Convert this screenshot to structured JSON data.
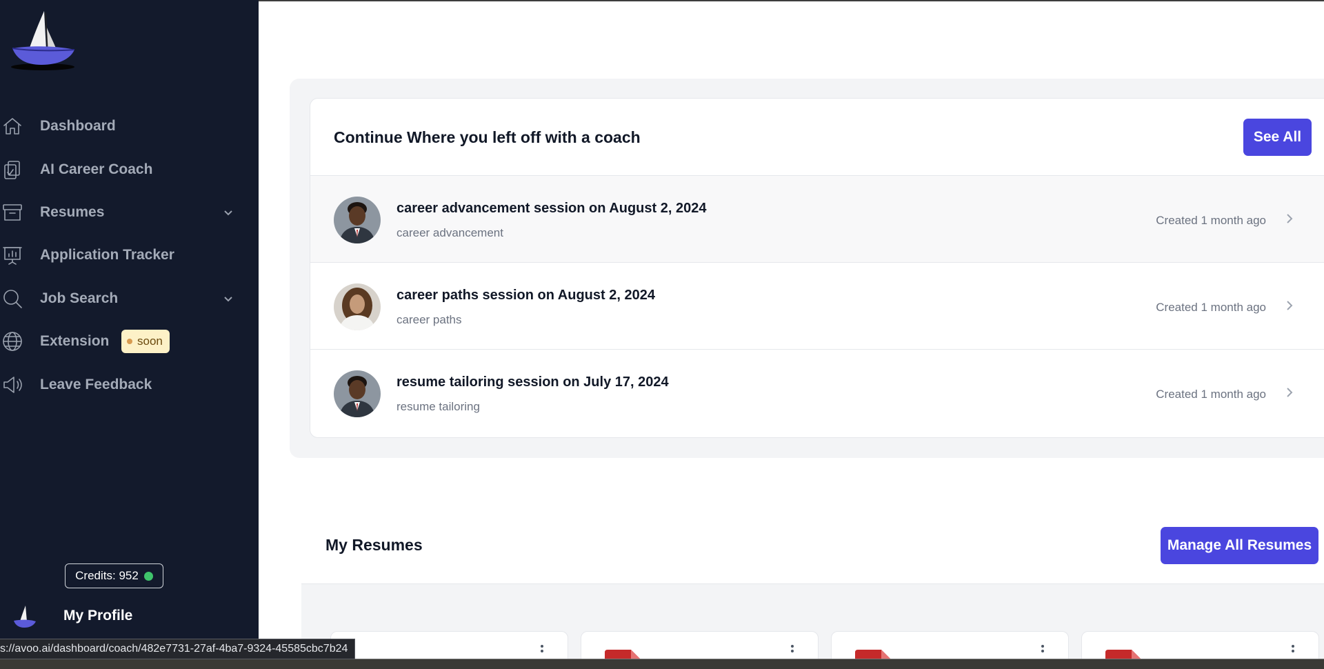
{
  "sidebar": {
    "items": [
      {
        "label": "Dashboard",
        "icon": "home-icon"
      },
      {
        "label": "AI Career Coach",
        "icon": "clipboard-check-icon"
      },
      {
        "label": "Resumes",
        "icon": "archive-icon"
      },
      {
        "label": "Application Tracker",
        "icon": "presentation-chart-icon"
      },
      {
        "label": "Job Search",
        "icon": "search-icon"
      },
      {
        "label": "Extension",
        "icon": "globe-icon"
      },
      {
        "label": "Leave Feedback",
        "icon": "megaphone-icon"
      }
    ],
    "soon_badge": "soon",
    "credits_label": "Credits: 952",
    "profile_label": "My Profile"
  },
  "status_url": "s://avoo.ai/dashboard/coach/482e7731-27af-4ba7-9324-45585cbc7b24",
  "coach": {
    "title": "Continue Where you left off with a coach",
    "see_all_label": "See All",
    "sessions": [
      {
        "title": "career advancement session on August 2, 2024",
        "subtitle": "career advancement",
        "created": "Created 1 month ago"
      },
      {
        "title": "career paths session on August 2, 2024",
        "subtitle": "career paths",
        "created": "Created 1 month ago"
      },
      {
        "title": "resume tailoring session on July 17, 2024",
        "subtitle": "resume tailoring",
        "created": "Created 1 month ago"
      }
    ]
  },
  "resumes": {
    "title": "My Resumes",
    "manage_label": "Manage All Resumes"
  },
  "colors": {
    "sidebar_bg": "#131a2c",
    "accent": "#4a46df",
    "badge_bg": "#fdf1c7",
    "credits_dot": "#3fc46b",
    "pdf_red": "#c52a2a"
  }
}
